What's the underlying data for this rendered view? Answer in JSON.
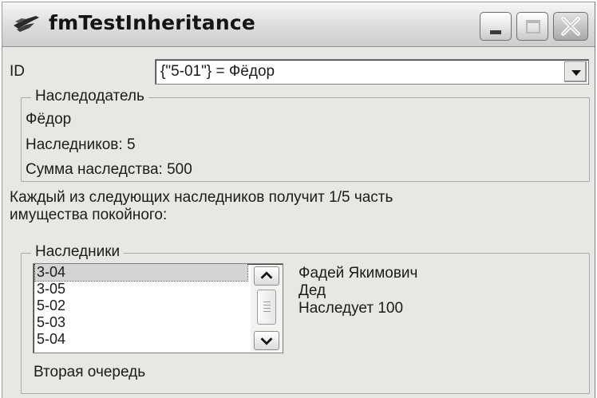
{
  "window": {
    "title": "fmTestInheritance",
    "icon": "inheritance-app-icon",
    "buttons": {
      "minimize": "minimize-icon",
      "maximize": "maximize-icon",
      "close": "close-icon"
    }
  },
  "id_field": {
    "label": "ID",
    "selected_value": "{\"5-01\"} = Фёдор"
  },
  "testator": {
    "caption": "Наследодатель",
    "name": "Фёдор",
    "heirs_count": "Наследников: 5",
    "inheritance_sum": "Сумма наследства: 500"
  },
  "message": {
    "line1": "Каждый из следующих наследников получит 1/5 часть",
    "line2": "имущества покойного:"
  },
  "heirs": {
    "caption": "Наследники",
    "items": [
      "3-04",
      "3-05",
      "5-02",
      "5-03",
      "5-04"
    ],
    "selected_index": 0,
    "detail": {
      "name": "Фадей Якимович",
      "relation": "Дед",
      "share": "Наследует 100"
    },
    "order": "Вторая очередь"
  },
  "colors": {
    "window_bg": "#e8e7e3",
    "selection_bg": "#d4d4d4",
    "close_button": "#b9b9b9"
  }
}
